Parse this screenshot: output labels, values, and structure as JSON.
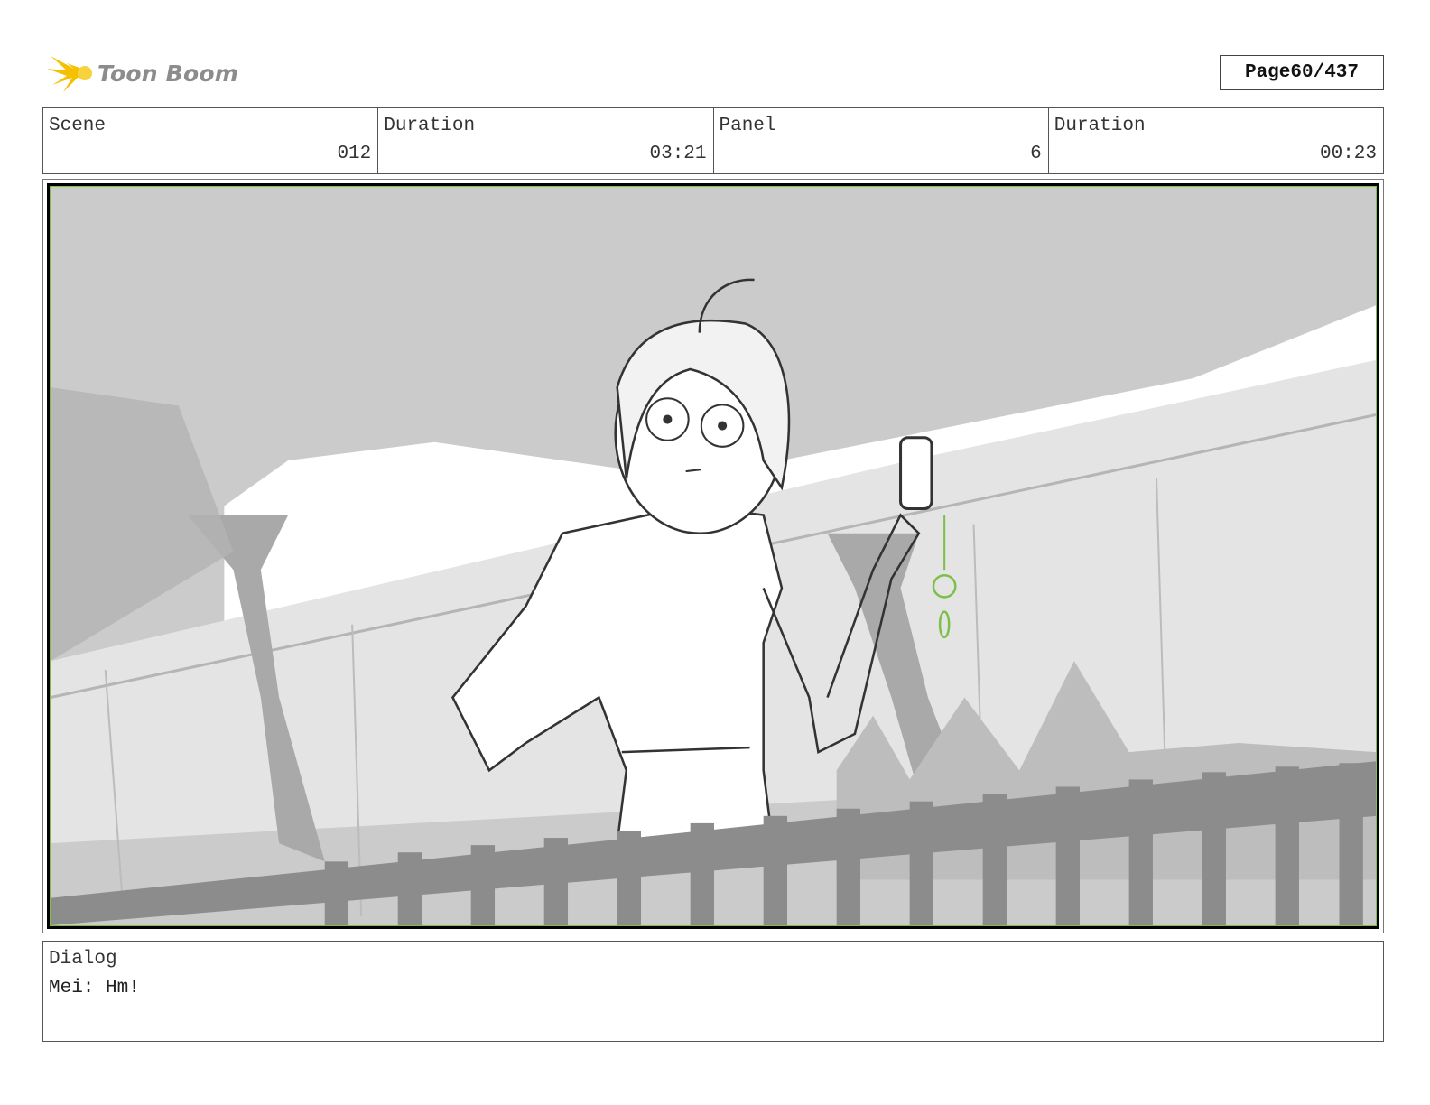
{
  "brand": {
    "name": "Toon Boom",
    "accent_color": "#f5c000",
    "icon": "starburst-icon"
  },
  "page": {
    "label": "Page",
    "number": "60/437"
  },
  "info": {
    "scene_label": "Scene",
    "scene_value": "012",
    "scene_duration_label": "Duration",
    "scene_duration_value": "03:21",
    "panel_label": "Panel",
    "panel_value": "6",
    "panel_duration_label": "Duration",
    "panel_duration_value": "00:23"
  },
  "panel": {
    "border_color": "#7cc04a"
  },
  "dialog": {
    "label": "Dialog",
    "text": "Mei: Hm!"
  }
}
